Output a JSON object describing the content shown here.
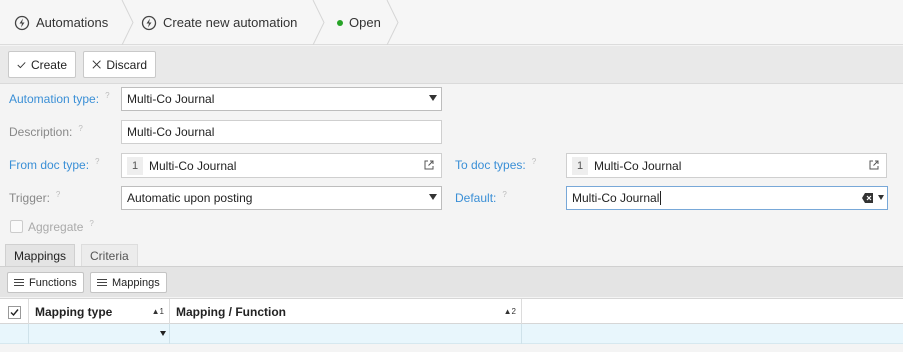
{
  "breadcrumb": {
    "items": [
      {
        "label": "Automations",
        "icon": "lightning-circle-icon"
      },
      {
        "label": "Create new automation",
        "icon": "lightning-circle-icon"
      },
      {
        "label": "Open",
        "icon": "status-dot-icon",
        "status_color": "#27a327"
      }
    ]
  },
  "toolbar": {
    "create_label": "Create",
    "discard_label": "Discard"
  },
  "form": {
    "automation_type": {
      "label": "Automation type:",
      "hint": "?",
      "value": "Multi-Co Journal"
    },
    "description": {
      "label": "Description:",
      "hint": "?",
      "value": "Multi-Co Journal"
    },
    "from_doc_type": {
      "label": "From doc type:",
      "hint": "?",
      "count": "1",
      "value": "Multi-Co Journal"
    },
    "to_doc_types": {
      "label": "To doc types:",
      "hint": "?",
      "count": "1",
      "value": "Multi-Co Journal"
    },
    "trigger": {
      "label": "Trigger:",
      "hint": "?",
      "value": "Automatic upon posting"
    },
    "default": {
      "label": "Default:",
      "hint": "?",
      "value": "Multi-Co Journal"
    },
    "aggregate": {
      "label": "Aggregate",
      "hint": "?",
      "checked": false
    }
  },
  "tabs": [
    {
      "label": "Mappings",
      "active": true
    },
    {
      "label": "Criteria",
      "active": false
    }
  ],
  "subtoolbar": {
    "functions_label": "Functions",
    "mappings_label": "Mappings"
  },
  "grid": {
    "columns": [
      {
        "label": "Mapping type",
        "sort": "▲1"
      },
      {
        "label": "Mapping / Function",
        "sort": "▲2"
      }
    ]
  },
  "colors": {
    "accent_label": "#3a8fd6",
    "status_open": "#27a327",
    "grid_row": "#e8f6fc"
  }
}
